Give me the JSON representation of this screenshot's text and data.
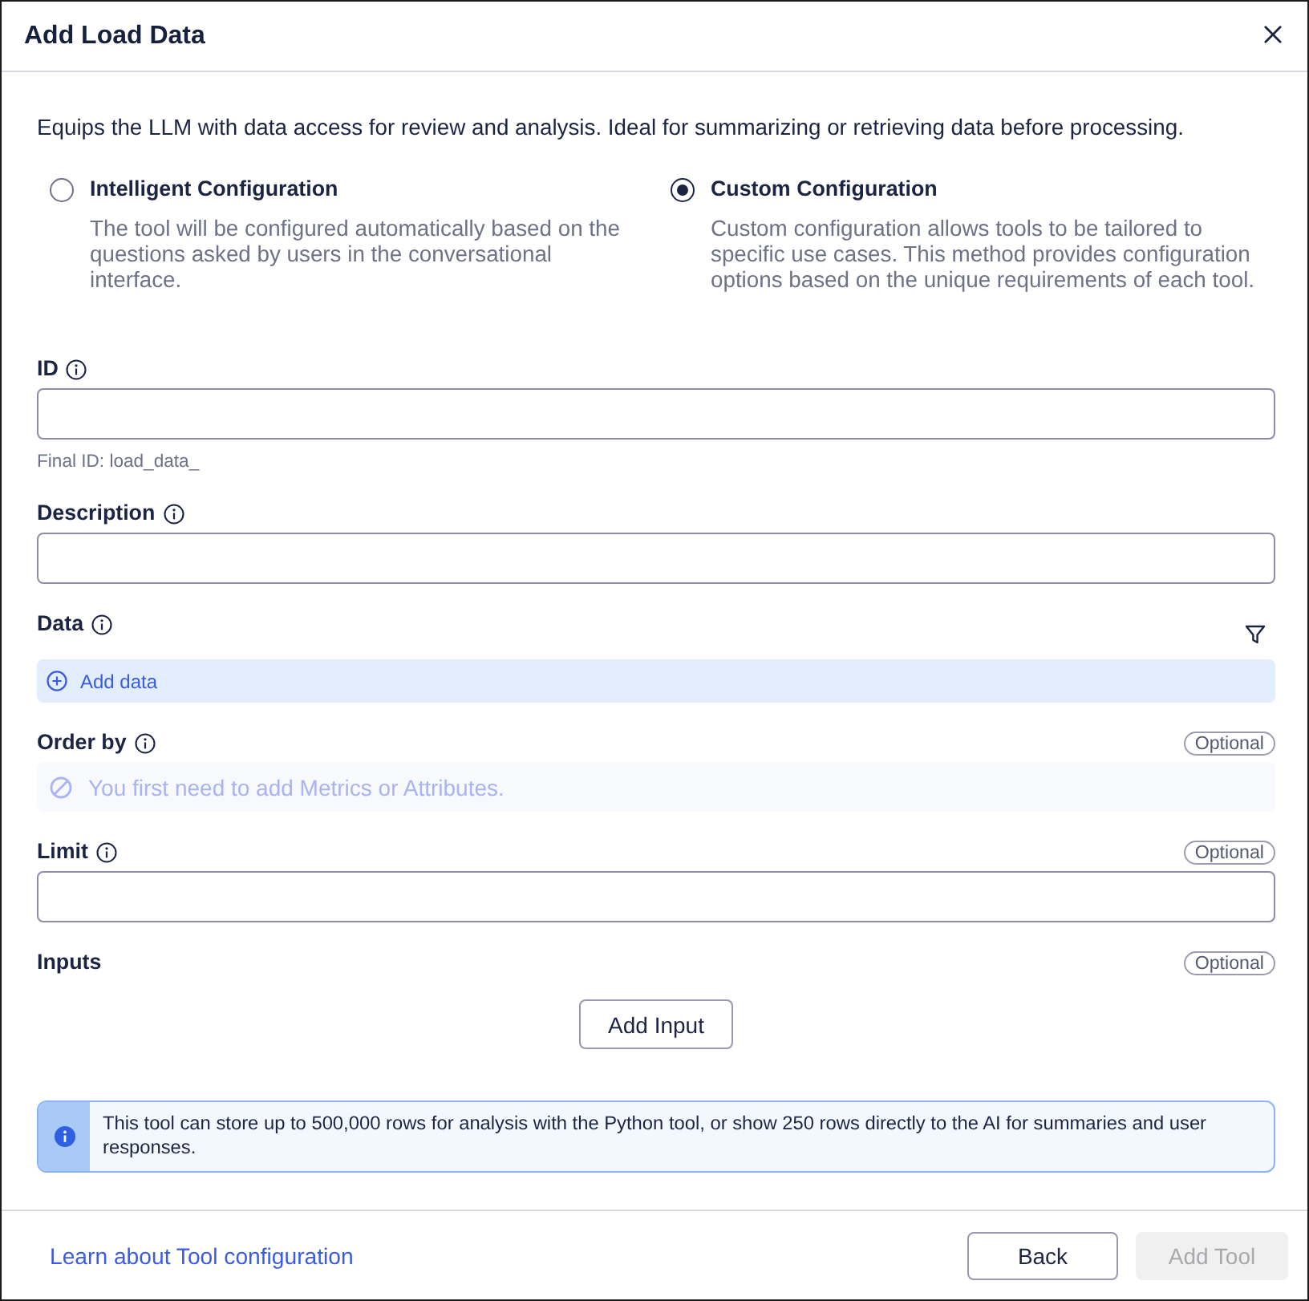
{
  "dialog": {
    "title": "Add Load Data"
  },
  "intro": "Equips the LLM with data access for review and analysis. Ideal for summarizing or retrieving data before processing.",
  "modes": [
    {
      "label": "Intelligent Configuration",
      "description": "The tool will be configured automatically based on the questions asked by users in the conversational interface.",
      "selected": false
    },
    {
      "label": "Custom Configuration",
      "description": "Custom configuration allows tools to be tailored to specific use cases. This method provides configuration options based on the unique requirements of each tool.",
      "selected": true
    }
  ],
  "fields": [
    {
      "kind": "text",
      "label": "ID",
      "info": true,
      "hint": "Final ID: load_data_"
    },
    {
      "kind": "text",
      "label": "Description",
      "info": true
    },
    {
      "kind": "data",
      "label": "Data",
      "info": true,
      "action": "Add data"
    },
    {
      "kind": "notice",
      "label": "Order by",
      "info": true,
      "badge": "Optional",
      "notice": "You first need to add Metrics or Attributes."
    },
    {
      "kind": "text",
      "label": "Limit",
      "info": true,
      "badge": "Optional"
    },
    {
      "kind": "inputs",
      "label": "Inputs",
      "info": false,
      "badge": "Optional",
      "button": "Add Input"
    }
  ],
  "info_banner": {
    "text": "This tool can store up to 500,000 rows for analysis with the Python tool, or show 250 rows directly to the AI for summaries and user responses."
  },
  "footer": {
    "link": "Learn about Tool configuration",
    "buttons": [
      {
        "kind": "secondary",
        "label": "Back",
        "disabled": false
      },
      {
        "kind": "primary",
        "label": "Add Tool",
        "disabled": true
      }
    ]
  }
}
